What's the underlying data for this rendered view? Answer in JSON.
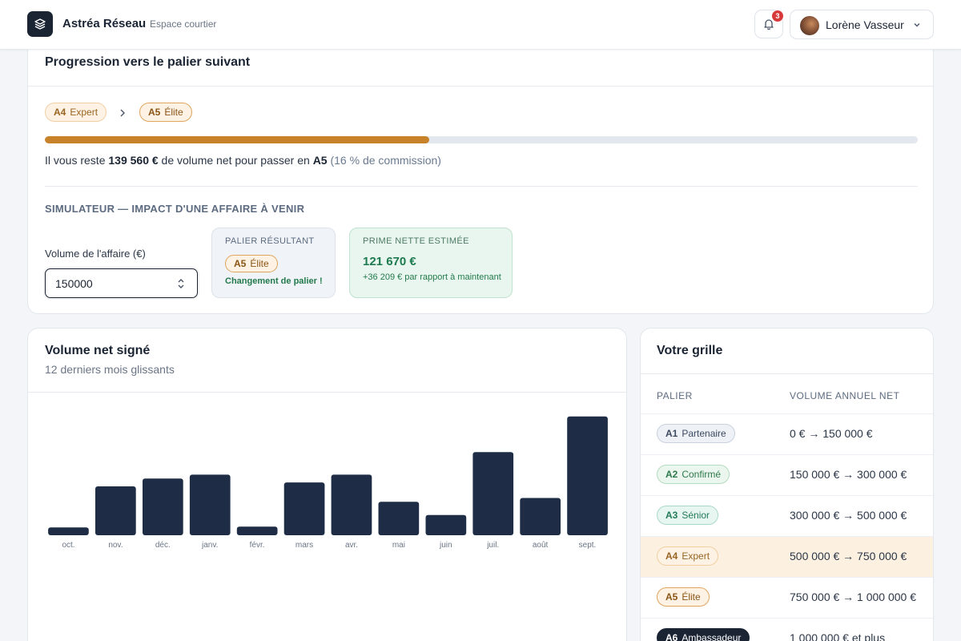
{
  "header": {
    "brand": "Astréa Réseau",
    "subtitle": "Espace courtier",
    "notifications_count": "3",
    "user_name": "Lorène Vasseur",
    "icons": [
      "layers-icon",
      "bell-icon",
      "chevron-down-icon"
    ]
  },
  "progress": {
    "title": "Progression vers le palier suivant",
    "current_tier": {
      "code": "A4",
      "name": "Expert"
    },
    "next_tier": {
      "code": "A5",
      "name": "Élite"
    },
    "progress_fraction": 0.44,
    "remaining_prefix": "Il vous reste ",
    "remaining_amount": "139 560 €",
    "remaining_middle": " de volume net pour passer en ",
    "remaining_tier": "A5",
    "remaining_note": " (16 % de commission)"
  },
  "simulator": {
    "title": "SIMULATEUR — IMPACT D'UNE AFFAIRE À VENIR",
    "volume_label": "Volume de l'affaire (€)",
    "volume_value": "150000",
    "result_caption": "PALIER RÉSULTANT",
    "result_tier": {
      "code": "A5",
      "name": "Élite"
    },
    "result_change": "Changement de palier !",
    "estimate_caption": "PRIME NETTE ESTIMÉE",
    "estimate_amount": "121 670 €",
    "estimate_delta": "+36 209 € par rapport à maintenant"
  },
  "volume_chart": {
    "title": "Volume net signé",
    "subtitle": "12 derniers mois glissants"
  },
  "chart_data": {
    "type": "bar",
    "title": "Volume net signé",
    "subtitle": "12 derniers mois glissants",
    "categories": [
      "oct.",
      "nov.",
      "déc.",
      "janv.",
      "févr.",
      "mars",
      "avr.",
      "mai",
      "juin",
      "juil.",
      "août",
      "sept."
    ],
    "values": [
      10,
      63,
      73,
      78,
      11,
      68,
      78,
      43,
      26,
      107,
      48,
      153
    ],
    "ylim": [
      0,
      160
    ],
    "color": "#1e2d45"
  },
  "grid": {
    "title": "Votre grille",
    "col_tier": "PALIER",
    "col_volume": "VOLUME ANNUEL NET",
    "rows": [
      {
        "code": "A1",
        "name": "Partenaire",
        "range": "0 € → 150 000 €"
      },
      {
        "code": "A2",
        "name": "Confirmé",
        "range": "150 000 € → 300 000 €"
      },
      {
        "code": "A3",
        "name": "Sénior",
        "range": "300 000 € → 500 000 €"
      },
      {
        "code": "A4",
        "name": "Expert",
        "range": "500 000 € → 750 000 €"
      },
      {
        "code": "A5",
        "name": "Élite",
        "range": "750 000 € → 1 000 000 €"
      },
      {
        "code": "A6",
        "name": "Ambassadeur",
        "range": "1 000 000 € et plus"
      }
    ],
    "current_index": 3
  }
}
